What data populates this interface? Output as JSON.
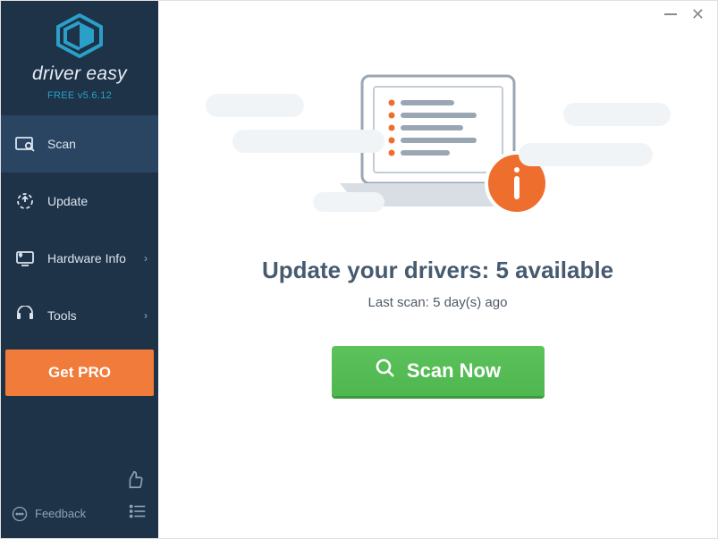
{
  "brand": {
    "name": "driver easy",
    "version": "FREE v5.6.12"
  },
  "nav": {
    "scan": {
      "label": "Scan"
    },
    "update": {
      "label": "Update"
    },
    "hardware": {
      "label": "Hardware Info"
    },
    "tools": {
      "label": "Tools"
    }
  },
  "pro_button": "Get PRO",
  "feedback_label": "Feedback",
  "main": {
    "headline_prefix": "Update your drivers: ",
    "available_count": "5",
    "headline_suffix": " available",
    "last_scan": "Last scan: 5 day(s) ago",
    "scan_button": "Scan Now"
  }
}
